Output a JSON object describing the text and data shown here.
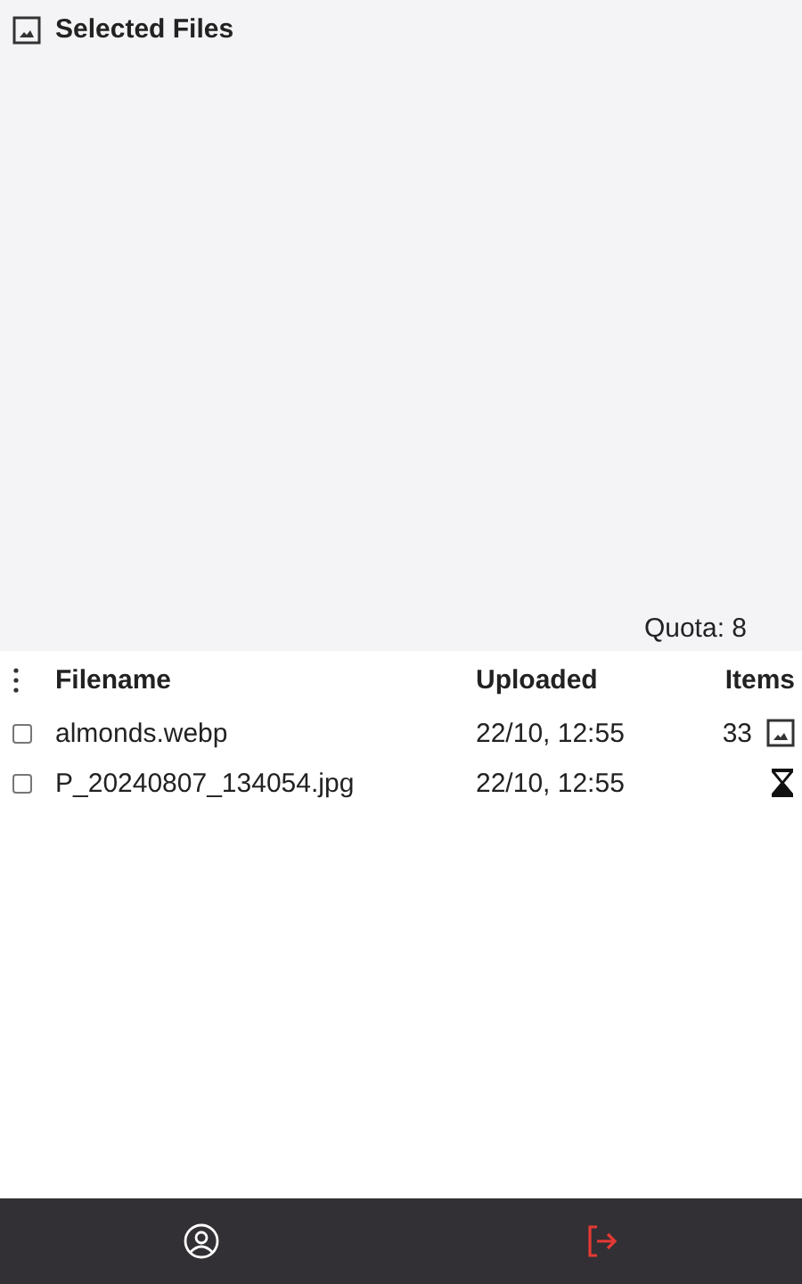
{
  "header": {
    "title": "Selected Files",
    "quota": "Quota: 8"
  },
  "table": {
    "columns": [
      "Filename",
      "Uploaded",
      "Items"
    ],
    "rows": [
      {
        "kind": "done",
        "checked": false,
        "filename": "almonds.webp",
        "uploaded": "22/10, 12:55",
        "items": "33"
      },
      {
        "kind": "pending",
        "checked": false,
        "filename": "P_20240807_134054.jpg",
        "uploaded": "22/10, 12:55"
      }
    ]
  },
  "bottom_bar": {
    "items": [
      {
        "kind": "profile"
      },
      {
        "kind": "logout"
      }
    ]
  }
}
